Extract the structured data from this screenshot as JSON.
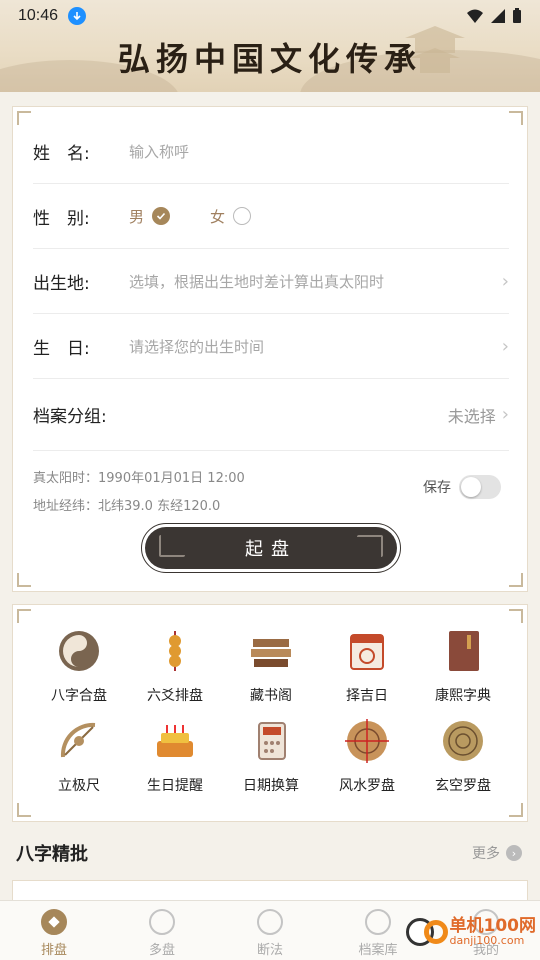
{
  "status_bar": {
    "time": "10:46"
  },
  "banner": {
    "title": "弘扬中国文化传承"
  },
  "form": {
    "name": {
      "label": "姓　名:",
      "placeholder": "输入称呼"
    },
    "gender": {
      "label": "性　别:",
      "male": "男",
      "female": "女"
    },
    "birthplace": {
      "label": "出生地:",
      "placeholder": "选填，根据出生地时差计算出真太阳时"
    },
    "birthday": {
      "label": "生　日:",
      "placeholder": "请选择您的出生时间"
    },
    "group": {
      "label": "档案分组:",
      "value": "未选择"
    },
    "solar_time": "真太阳时：1990年01月01日 12:00",
    "coords": "地址经纬：北纬39.0 东经120.0",
    "save_label": "保存",
    "submit_label": "起盘"
  },
  "tools": [
    {
      "label": "八字合盘",
      "icon": "yinyang-icon",
      "color": "#6b5a45"
    },
    {
      "label": "六爻排盘",
      "icon": "coins-icon",
      "color": "#d48a2a"
    },
    {
      "label": "藏书阁",
      "icon": "books-icon",
      "color": "#9a6b44"
    },
    {
      "label": "择吉日",
      "icon": "calendar-icon",
      "color": "#c44a2a"
    },
    {
      "label": "康熙字典",
      "icon": "dictionary-icon",
      "color": "#8a4a3a"
    },
    {
      "label": "立极尺",
      "icon": "sextant-icon",
      "color": "#b49060"
    },
    {
      "label": "生日提醒",
      "icon": "cake-icon",
      "color": "#e0a020"
    },
    {
      "label": "日期换算",
      "icon": "calculator-icon",
      "color": "#a08070"
    },
    {
      "label": "风水罗盘",
      "icon": "compass-icon",
      "color": "#b87a3a"
    },
    {
      "label": "玄空罗盘",
      "icon": "luopan-icon",
      "color": "#9a8050"
    }
  ],
  "section": {
    "title": "八字精批",
    "more": "更多"
  },
  "bottom_nav": [
    {
      "label": "排盘",
      "icon": "paipan-icon",
      "active": true
    },
    {
      "label": "多盘",
      "icon": "multi-icon",
      "active": false
    },
    {
      "label": "断法",
      "icon": "taiji-icon",
      "active": false
    },
    {
      "label": "档案库",
      "icon": "folder-icon",
      "active": false
    },
    {
      "label": "我的",
      "icon": "profile-icon",
      "active": false
    }
  ],
  "watermark": {
    "text": "单机100网",
    "sub": "danji100.com"
  },
  "colors": {
    "accent": "#a6875a",
    "dark_button": "#3b3633",
    "background": "#f4f1ea"
  }
}
